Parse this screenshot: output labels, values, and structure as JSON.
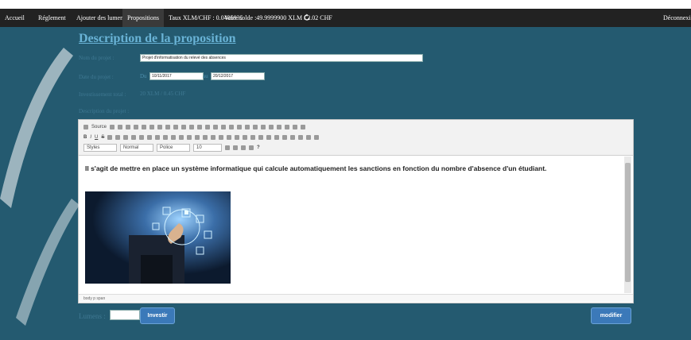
{
  "nav": {
    "items": [
      "Accueil",
      "Réglement",
      "Ajouter des lumens",
      "Propositions"
    ],
    "rate": "Taux XLM/CHF : 0.0405935",
    "balance": "Votre solde :49.9999900 XLM / 2.02 CHF",
    "logout": "Déconnexion",
    "active_color": "#3a3a3a"
  },
  "page": {
    "title": "Description de la proposition",
    "labels": {
      "project_name": "Nom du projet :",
      "project_date": "Date du projet :",
      "investment": "Investissement total :",
      "description": "Description du projet :"
    },
    "project_name_value": "Projet d'informatisation du relevé des absences",
    "date_from_label": "Du",
    "date_from": "10/11/2017",
    "date_to_label": "au",
    "date_to": "20/12/2017",
    "investment_value": "20 XLM / 0.45 CHF"
  },
  "editor": {
    "toolbar": {
      "source": "Source",
      "styles": "Styles",
      "format": "Normal",
      "font": "Police",
      "size": "10"
    },
    "content": "Il s'agit de mettre en place un système informatique qui calcule automatiquement les sanctions en fonction du nombre d'absence d'un étudiant.",
    "status_path": "body  p  span"
  },
  "footer": {
    "lumens_label": "Lumens :",
    "lumens_value": "",
    "invest_button": "Investir",
    "modify_button": "modifier"
  },
  "colors": {
    "background": "#245a70",
    "navbar": "#222222",
    "title": "#69b3d6",
    "labels": "#3f7892",
    "button": "#3b79b9"
  }
}
